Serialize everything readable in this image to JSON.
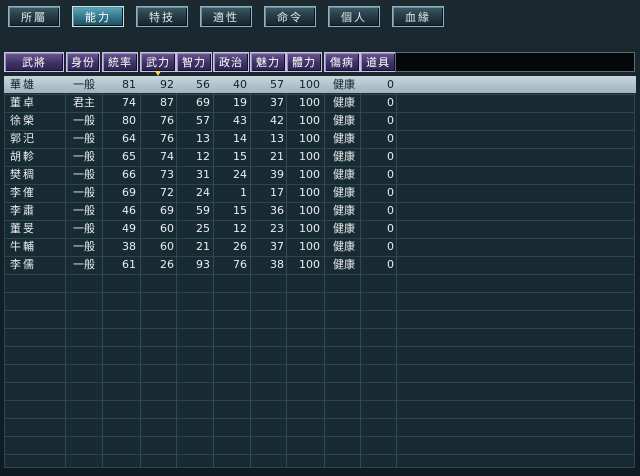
{
  "tabs": [
    {
      "label": "所屬",
      "active": false
    },
    {
      "label": "能力",
      "active": true
    },
    {
      "label": "特技",
      "active": false
    },
    {
      "label": "適性",
      "active": false
    },
    {
      "label": "命令",
      "active": false
    },
    {
      "label": "個人",
      "active": false
    },
    {
      "label": "血緣",
      "active": false
    }
  ],
  "columns": [
    "武將",
    "身份",
    "統率",
    "武力",
    "智力",
    "政治",
    "魅力",
    "體力",
    "傷病",
    "道具"
  ],
  "sorted_column": "武力",
  "rows": [
    {
      "name": "華雄",
      "role": "一般",
      "tong": "81",
      "wu": "92",
      "zhi": "56",
      "zheng": "40",
      "mei": "57",
      "ti": "100",
      "health": "健康",
      "items": "0"
    },
    {
      "name": "董卓",
      "role": "君主",
      "tong": "74",
      "wu": "87",
      "zhi": "69",
      "zheng": "19",
      "mei": "37",
      "ti": "100",
      "health": "健康",
      "items": "0"
    },
    {
      "name": "徐榮",
      "role": "一般",
      "tong": "80",
      "wu": "76",
      "zhi": "57",
      "zheng": "43",
      "mei": "42",
      "ti": "100",
      "health": "健康",
      "items": "0"
    },
    {
      "name": "郭汜",
      "role": "一般",
      "tong": "64",
      "wu": "76",
      "zhi": "13",
      "zheng": "14",
      "mei": "13",
      "ti": "100",
      "health": "健康",
      "items": "0"
    },
    {
      "name": "胡軫",
      "role": "一般",
      "tong": "65",
      "wu": "74",
      "zhi": "12",
      "zheng": "15",
      "mei": "21",
      "ti": "100",
      "health": "健康",
      "items": "0"
    },
    {
      "name": "樊稠",
      "role": "一般",
      "tong": "66",
      "wu": "73",
      "zhi": "31",
      "zheng": "24",
      "mei": "39",
      "ti": "100",
      "health": "健康",
      "items": "0"
    },
    {
      "name": "李傕",
      "role": "一般",
      "tong": "69",
      "wu": "72",
      "zhi": "24",
      "zheng": "1",
      "mei": "17",
      "ti": "100",
      "health": "健康",
      "items": "0"
    },
    {
      "name": "李肅",
      "role": "一般",
      "tong": "46",
      "wu": "69",
      "zhi": "59",
      "zheng": "15",
      "mei": "36",
      "ti": "100",
      "health": "健康",
      "items": "0"
    },
    {
      "name": "董旻",
      "role": "一般",
      "tong": "49",
      "wu": "60",
      "zhi": "25",
      "zheng": "12",
      "mei": "23",
      "ti": "100",
      "health": "健康",
      "items": "0"
    },
    {
      "name": "牛輔",
      "role": "一般",
      "tong": "38",
      "wu": "60",
      "zhi": "21",
      "zheng": "26",
      "mei": "37",
      "ti": "100",
      "health": "健康",
      "items": "0"
    },
    {
      "name": "李儒",
      "role": "一般",
      "tong": "61",
      "wu": "26",
      "zhi": "93",
      "zheng": "76",
      "mei": "38",
      "ti": "100",
      "health": "健康",
      "items": "0"
    }
  ],
  "selected_row": 0
}
